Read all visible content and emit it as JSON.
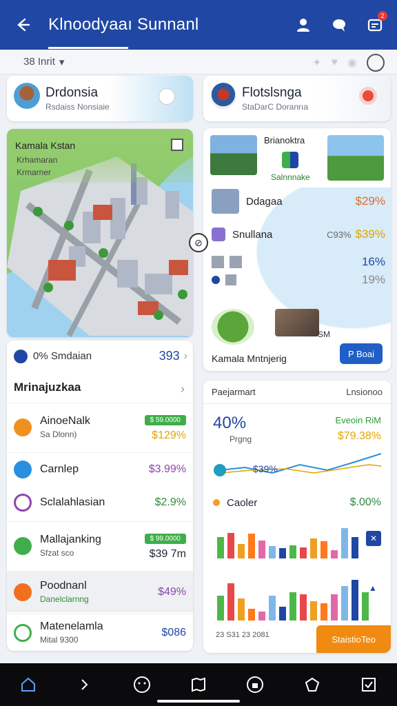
{
  "app": {
    "title": "Klnoodyaaı Sunnanl",
    "badge_count": "2"
  },
  "subbar": {
    "selector": "38 Inrit"
  },
  "cards": {
    "location_left": {
      "title": "Drdonsia",
      "subtitle": "Rsdaiss Nonsiaie"
    },
    "location_right": {
      "title": "Flotslsnga",
      "subtitle": "StaDarC Doranrıa"
    },
    "map": {
      "title": "Kamala Kstan",
      "line1": "Krhamaran",
      "line2": "Krmarner"
    },
    "promo": {
      "title": "Brianoktra",
      "subtitle": "Salnnnake",
      "rows": [
        {
          "label": "Ddagaa",
          "value": "$29%",
          "color": "#e06a2b"
        },
        {
          "label": "Snullana",
          "value": "$39%",
          "prefix": "C93%",
          "color": "#e2a500"
        }
      ],
      "mini_rows": [
        {
          "value": "16%",
          "color": "#1f47a3"
        },
        {
          "value": "19%",
          "color": "#888888"
        }
      ],
      "side_label": "SM",
      "footer": "Kamala Mntnjerig",
      "button": "P Boai"
    },
    "list": {
      "head_label": "0% Smdaian",
      "head_value": "393",
      "section_title": "Mrinajuzkaa",
      "items": [
        {
          "title": "AinoeNalk",
          "subtitle": "Sa Dlonn)",
          "amount": "$129%",
          "pill": "$ 59.0000",
          "amount_color": "#e2a500",
          "icon_color": "#f09020"
        },
        {
          "title": "Carnlep",
          "subtitle": "",
          "amount": "$3.99%",
          "amount_color": "#8e44ad",
          "icon_color": "#2a8fe0"
        },
        {
          "title": "Sclalahlasian",
          "subtitle": "",
          "amount": "$2.9%",
          "amount_color": "#2e8b3c",
          "icon_color": "#8e44ad"
        },
        {
          "title": "Mallajanking",
          "subtitle": "Sfzat sco",
          "amount": "$39 7m",
          "pill": "$ 99.0000",
          "amount_color": "#1d2433",
          "icon_color": "#3fae4a"
        },
        {
          "title": "Poodnanl",
          "subtitle": "Danelclarnng",
          "amount": "$49%",
          "amount_color": "#8e44ad",
          "icon_color": "#f07020",
          "highlight": true
        },
        {
          "title": "Matenelamla",
          "subtitle": "Mital 9300",
          "amount": "$086",
          "amount_color": "#1f47a3",
          "icon_color": "#3fae4a"
        }
      ]
    },
    "stats": {
      "header_left": "Paejarmart",
      "header_right": "Lnsionoo",
      "big_value": "40%",
      "big_sub": "Prgng",
      "right_label": "Eveoin RiM",
      "right_value": "$79.38%",
      "line_label": "$39%",
      "cancel_label": "Caoler",
      "cancel_value": "$.00%",
      "footer_left": "23   S31     23 2081",
      "button": "StaistioTeo"
    }
  },
  "chart_data": {
    "type": "bar",
    "title": "",
    "series": [
      {
        "values": [
          0.6,
          0.72,
          0.4,
          0.7,
          0.5,
          0.34,
          0.28,
          0.36,
          0.3,
          0.56,
          0.48,
          0.24,
          0.85,
          0.6
        ]
      },
      {
        "values": [
          0.55,
          0.82,
          0.48,
          0.26,
          0.2,
          0.55,
          0.3,
          0.62,
          0.58,
          0.42,
          0.38,
          0.58,
          0.75,
          0.9,
          0.62
        ]
      }
    ],
    "colors": [
      "#4db848",
      "#e8484a",
      "#f0a020",
      "#ff7a1a",
      "#e06aa8",
      "#7fb8e8",
      "#1f47a3"
    ]
  },
  "nav": {
    "items": [
      "home",
      "undo",
      "smile",
      "map",
      "lock",
      "shield",
      "check"
    ]
  }
}
